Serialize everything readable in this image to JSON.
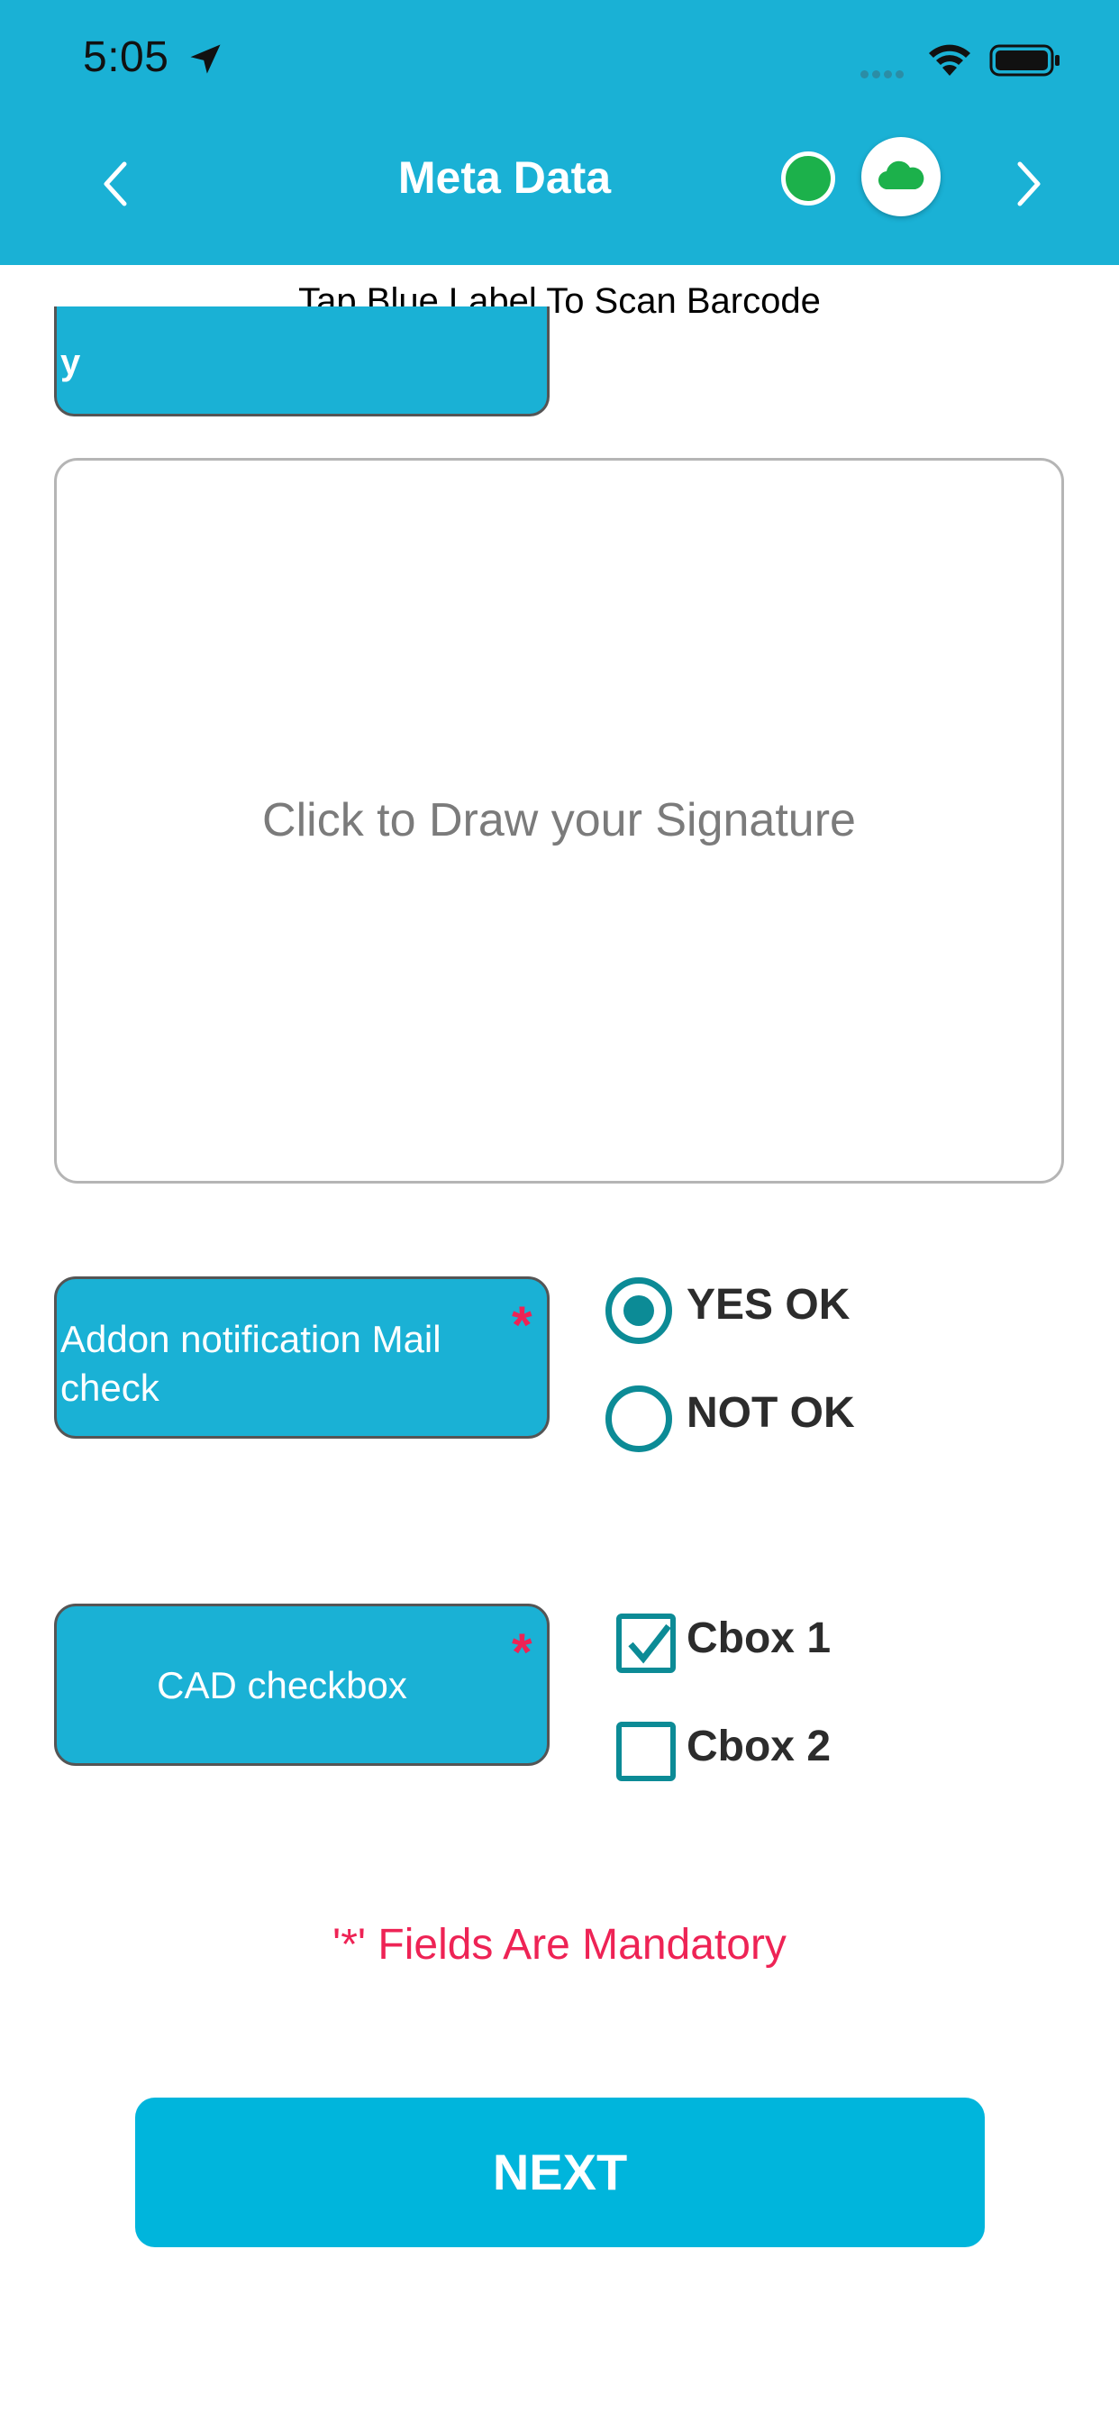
{
  "status_bar": {
    "time": "5:05"
  },
  "header": {
    "title": "Meta Data"
  },
  "subtitle": "Tap Blue Label To Scan Barcode",
  "cropped_label": {
    "text": "y"
  },
  "signature": {
    "placeholder": "Click to Draw your Signature"
  },
  "fields": {
    "mail_check": {
      "label": "Addon notification Mail check",
      "required": "*",
      "options": [
        {
          "label": "YES OK",
          "selected": true
        },
        {
          "label": "NOT OK",
          "selected": false
        }
      ]
    },
    "cad_checkbox": {
      "label": "CAD checkbox",
      "required": "*",
      "options": [
        {
          "label": "Cbox 1",
          "checked": true
        },
        {
          "label": "Cbox 2",
          "checked": false
        }
      ]
    }
  },
  "mandatory_note": "'*' Fields Are Mandatory",
  "next_button": {
    "label": "NEXT"
  },
  "colors": {
    "header_bg": "#1ab1d5",
    "accent_teal": "#0c8b96",
    "required_red": "#ee2355",
    "button_bg": "#00b5dc",
    "status_green": "#1cb14b"
  },
  "icons": [
    "location-arrow-icon",
    "wifi-icon",
    "battery-icon",
    "chevron-left-icon",
    "chevron-right-icon",
    "cloud-icon",
    "checkmark-icon"
  ]
}
